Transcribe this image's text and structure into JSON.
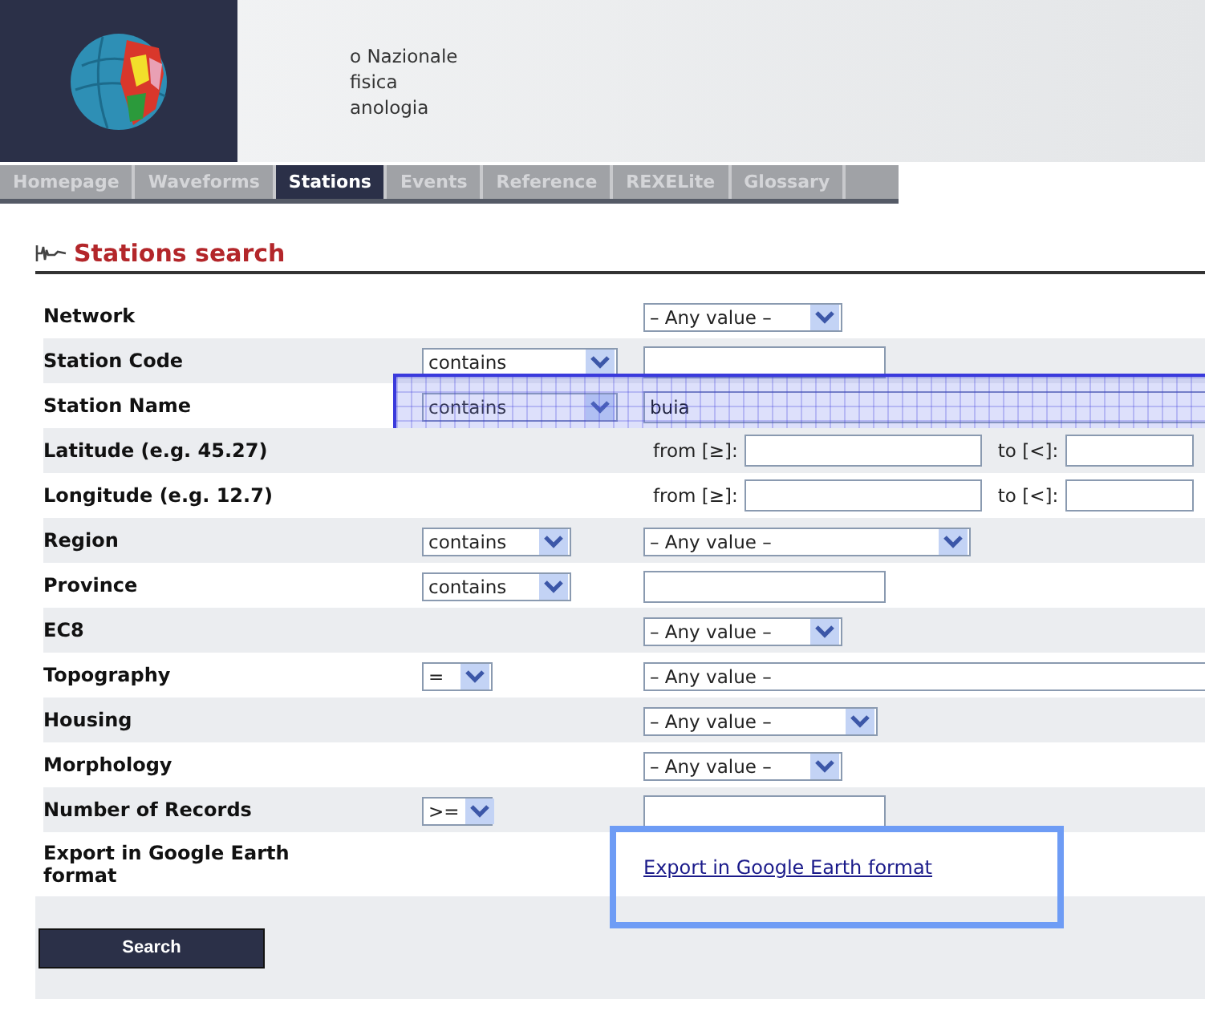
{
  "header": {
    "title_lines": [
      "o Nazionale",
      "fisica",
      "anologia"
    ]
  },
  "nav": [
    {
      "label": "Homepage",
      "selected": false
    },
    {
      "label": "Waveforms",
      "selected": false
    },
    {
      "label": "Stations",
      "selected": true
    },
    {
      "label": "Events",
      "selected": false
    },
    {
      "label": "Reference",
      "selected": false
    },
    {
      "label": "REXELite",
      "selected": false
    },
    {
      "label": "Glossary",
      "selected": false
    }
  ],
  "title": "Stations search",
  "rows": [
    {
      "label": "Network",
      "highlighted": false,
      "value": {
        "kind": "dropdown",
        "text": "– Any value –"
      }
    },
    {
      "label": "Station Code",
      "highlighted": false,
      "operator": {
        "text": "contains",
        "kind": "wide"
      },
      "value": {
        "kind": "input"
      }
    },
    {
      "label": "Station Name",
      "highlighted": true,
      "operator": {
        "text": "contains",
        "kind": "wide"
      },
      "value": {
        "kind": "fullinput",
        "text": "buia"
      }
    },
    {
      "label": "Latitude (e.g. 45.27)",
      "highlighted": false,
      "value": {
        "kind": "range",
        "from": "from [≥]:",
        "to": "to [<]:"
      }
    },
    {
      "label": "Longitude (e.g. 12.7)",
      "highlighted": false,
      "value": {
        "kind": "range",
        "from": "from [≥]:",
        "to": "to [<]:"
      }
    },
    {
      "label": "Region",
      "highlighted": false,
      "operator": {
        "text": "contains",
        "kind": "medium"
      },
      "value": {
        "kind": "largedropdown",
        "text": "– Any value –"
      }
    },
    {
      "label": "Province",
      "highlighted": false,
      "operator": {
        "text": "contains",
        "kind": "medium"
      },
      "value": {
        "kind": "input"
      }
    },
    {
      "label": "EC8",
      "highlighted": false,
      "value": {
        "kind": "dropdown",
        "text": "– Any value –"
      }
    },
    {
      "label": "Topography",
      "highlighted": false,
      "operator": {
        "text": "=",
        "kind": "tiny"
      },
      "value": {
        "kind": "fulldropdown",
        "text": "– Any value –"
      }
    },
    {
      "label": "Housing",
      "highlighted": false,
      "value": {
        "kind": "mediumdropdown",
        "text": "– Any value –"
      }
    },
    {
      "label": "Morphology",
      "highlighted": false,
      "value": {
        "kind": "dropdown",
        "text": "– Any value –"
      }
    },
    {
      "label": "Number of Records",
      "highlighted": false,
      "operator": {
        "text": ">=",
        "kind": "tiny"
      },
      "value": {
        "kind": "input"
      }
    },
    {
      "label": "Export in Google Earth format",
      "highlighted": true,
      "value": {
        "kind": "link",
        "text": "Export in Google Earth format"
      }
    }
  ],
  "search_button": "Search"
}
